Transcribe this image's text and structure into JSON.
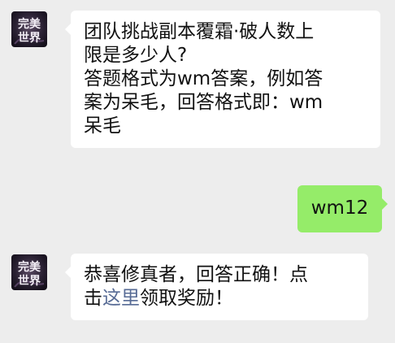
{
  "colors": {
    "background": "#ededed",
    "incoming_bubble": "#ffffff",
    "outgoing_bubble": "#95ec69",
    "link": "#576b95"
  },
  "messages": [
    {
      "sender": "bot",
      "avatar": {
        "icon": "game-logo-icon",
        "text": "完美世界"
      },
      "lines": [
        "团队挑战副本覆霜·破人数上",
        "限是多少人?",
        "答题格式为wm答案，例如答",
        "案为呆毛，回答格式即：wm",
        "呆毛"
      ]
    },
    {
      "sender": "user",
      "text": "wm12"
    },
    {
      "sender": "bot",
      "avatar": {
        "icon": "game-logo-icon",
        "text": "完美世界"
      },
      "line1": "恭喜修真者，回答正确！点",
      "line2_prefix": "击",
      "link_text": "这里",
      "line2_suffix": "领取奖励！"
    }
  ]
}
